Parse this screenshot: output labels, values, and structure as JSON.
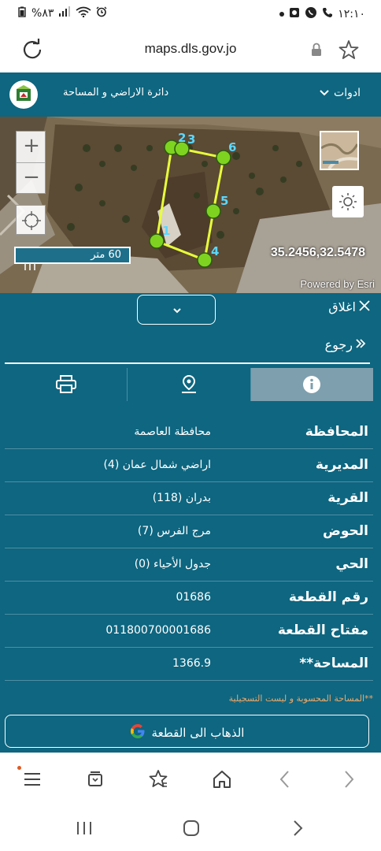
{
  "status_bar": {
    "time": "١٢:١٠",
    "battery": "%٨٣",
    "left_icons": [
      "battery-icon",
      "signal-icon",
      "wifi-icon",
      "alarm-icon"
    ],
    "right_icons": [
      "notification-dot",
      "gallery-icon",
      "whatsapp-icon",
      "phone-icon"
    ]
  },
  "browser": {
    "url": "maps.dls.gov.jo"
  },
  "header": {
    "department": "دائرة الاراضي و المساحة",
    "tools_label": "ادوات"
  },
  "map": {
    "scale_label": "60 متر",
    "coordinates": "35.2456,32.5478",
    "powered_by": "Powered by Esri",
    "vertex_labels": [
      "2",
      "3",
      "6",
      "5",
      "4",
      "1"
    ],
    "parcel_color": "#e8ff3a",
    "vertex_color": "#7ed321"
  },
  "panel": {
    "close_label": "اغلاق",
    "back_label": "رجوع",
    "tabs": [
      {
        "name": "print",
        "icon": "printer-icon"
      },
      {
        "name": "location",
        "icon": "map-pin-icon"
      },
      {
        "name": "info",
        "icon": "info-icon",
        "active": true
      }
    ],
    "rows": [
      {
        "label": "المحافظة",
        "value": "محافظة العاصمة"
      },
      {
        "label": "المديرية",
        "value": "اراضي شمال عمان (4)"
      },
      {
        "label": "القرية",
        "value": "بدران (118)"
      },
      {
        "label": "الحوض",
        "value": "مرج الفرس (7)"
      },
      {
        "label": "الحي",
        "value": "جدول الأحياء (0)"
      },
      {
        "label": "رقم القطعة",
        "value": "01686"
      },
      {
        "label": "مفتاح القطعة",
        "value": "011800700001686"
      },
      {
        "label": "المساحة**",
        "value": "1366.9"
      }
    ],
    "note": "**المساحة المحسوبة و ليست التسجيلية",
    "goto_label": "الذهاب الى القطعة"
  },
  "colors": {
    "primary": "#0e6680",
    "active_tab": "#7e9fae",
    "note": "#f0a868"
  }
}
